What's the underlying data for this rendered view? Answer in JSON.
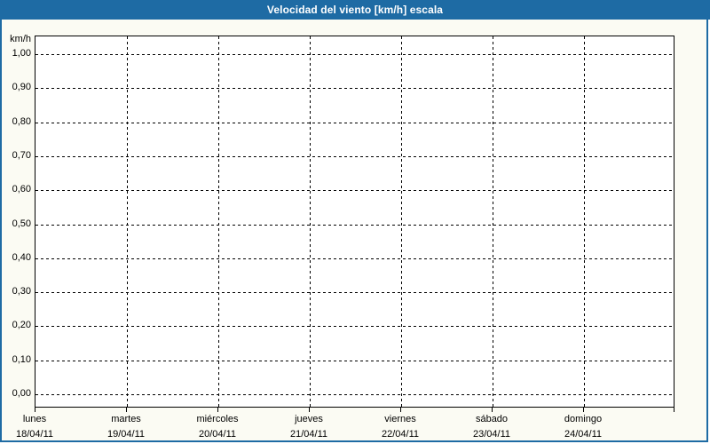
{
  "title_bar": {
    "title": "Velocidad del viento [km/h] escala"
  },
  "colors": {
    "accent": "#1e6ba4",
    "panel_bg": "#fbfbf3",
    "plot_bg": "#ffffff",
    "grid": "#000000",
    "text": "#000000"
  },
  "chart_data": {
    "type": "line",
    "title": "Velocidad del viento [km/h] escala",
    "ylabel": "km/h",
    "ylim": [
      0,
      1
    ],
    "ytick_step": 0.1,
    "ytick_labels": [
      "1,00",
      "0,90",
      "0,80",
      "0,70",
      "0,60",
      "0,50",
      "0,40",
      "0,30",
      "0,20",
      "0,10",
      "0,00"
    ],
    "grid": true,
    "decimal_separator": ",",
    "categories": [
      {
        "day": "lunes",
        "date": "18/04/11"
      },
      {
        "day": "martes",
        "date": "19/04/11"
      },
      {
        "day": "miércoles",
        "date": "20/04/11"
      },
      {
        "day": "jueves",
        "date": "21/04/11"
      },
      {
        "day": "viernes",
        "date": "22/04/11"
      },
      {
        "day": "sábado",
        "date": "23/04/11"
      },
      {
        "day": "domingo",
        "date": "24/04/11"
      }
    ],
    "series": []
  }
}
